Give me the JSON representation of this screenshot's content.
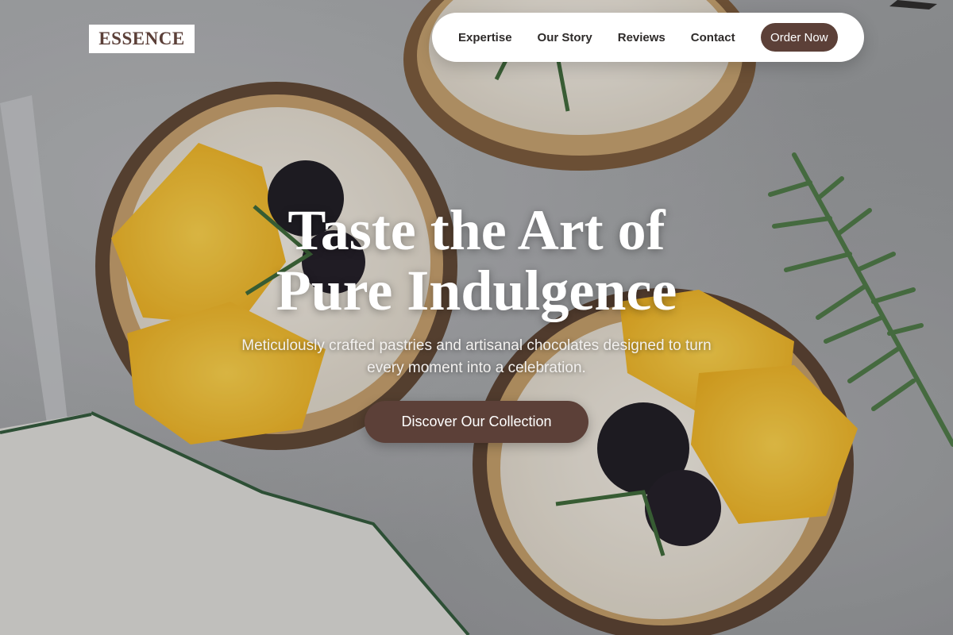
{
  "brand": {
    "logo_text": "ESSENCE"
  },
  "nav": {
    "links": [
      "Expertise",
      "Our Story",
      "Reviews",
      "Contact"
    ],
    "cta_label": "Order Now"
  },
  "hero": {
    "title_line1": "Taste the Art of",
    "title_line2": "Pure Indulgence",
    "subtitle_line1": "Meticulously crafted pastries and artisanal chocolates designed to turn",
    "subtitle_line2": "every moment into a celebration.",
    "cta_label": "Discover Our Collection"
  },
  "colors": {
    "brand_brown": "#5c4038",
    "logo_text": "#5b3f38",
    "nav_bg": "#ffffff",
    "title_text": "#ffffff"
  }
}
